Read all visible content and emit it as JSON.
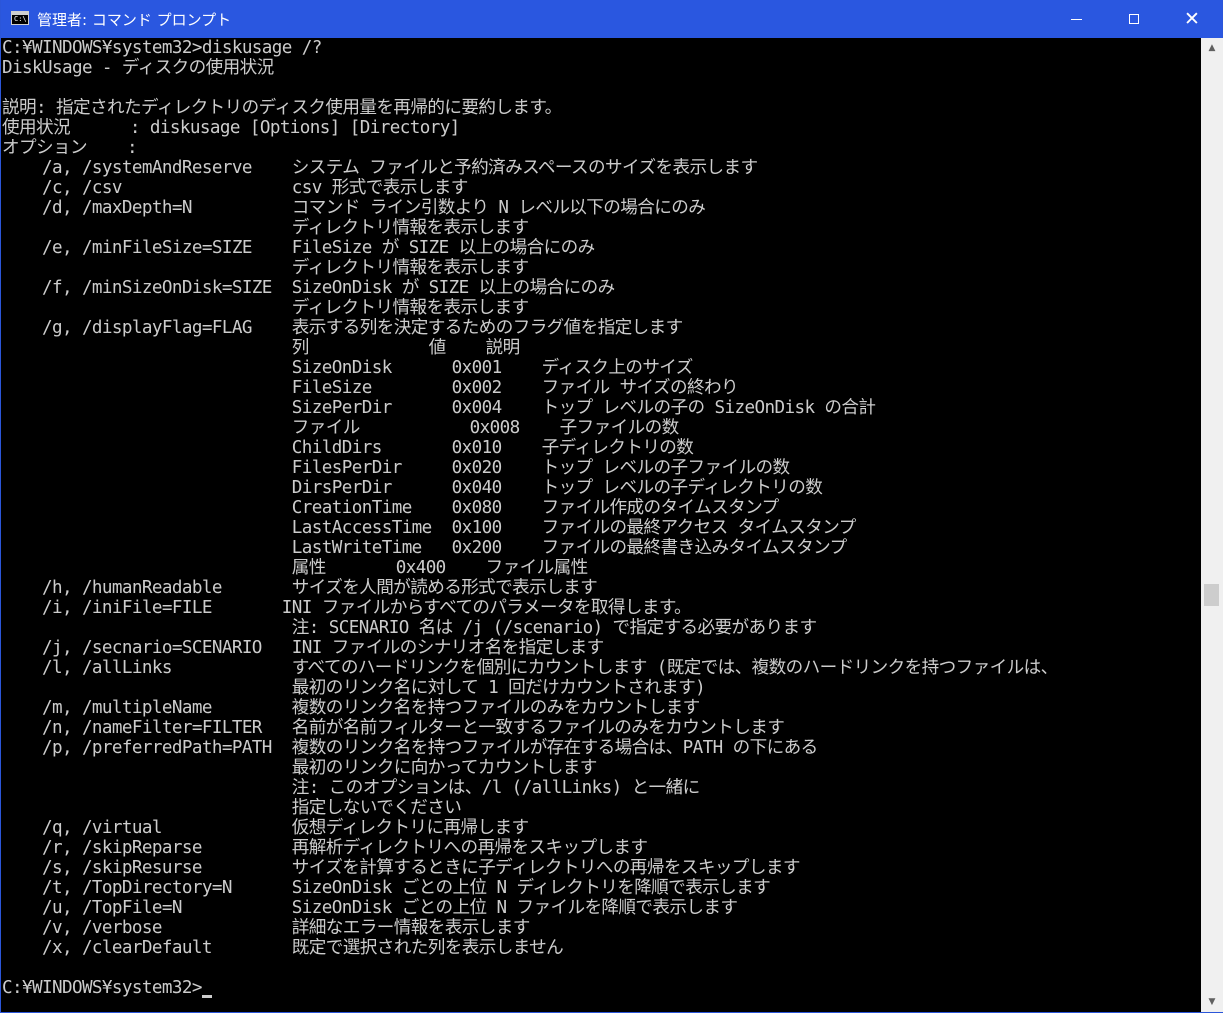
{
  "window": {
    "title": "管理者: コマンド プロンプト",
    "icon_text": "C:\\",
    "buttons": {
      "minimize": "minimize",
      "maximize": "maximize",
      "close": "✕"
    }
  },
  "console": {
    "lines": [
      "C:¥WINDOWS¥system32>diskusage /?",
      "DiskUsage - ディスクの使用状況",
      "",
      "説明: 指定されたディレクトリのディスク使用量を再帰的に要約します。",
      "使用状況      : diskusage [Options] [Directory]",
      "オプション    :",
      "    /a, /systemAndReserve    システム ファイルと予約済みスペースのサイズを表示します",
      "    /c, /csv                 csv 形式で表示します",
      "    /d, /maxDepth=N          コマンド ライン引数より N レベル以下の場合にのみ",
      "                             ディレクトリ情報を表示します",
      "    /e, /minFileSize=SIZE    FileSize が SIZE 以上の場合にのみ",
      "                             ディレクトリ情報を表示します",
      "    /f, /minSizeOnDisk=SIZE  SizeOnDisk が SIZE 以上の場合にのみ",
      "                             ディレクトリ情報を表示します",
      "    /g, /displayFlag=FLAG    表示する列を決定するためのフラグ値を指定します",
      "                             列            値    説明",
      "                             SizeOnDisk      0x001    ディスク上のサイズ",
      "                             FileSize        0x002    ファイル サイズの終わり",
      "                             SizePerDir      0x004    トップ レベルの子の SizeOnDisk の合計",
      "                             ファイル           0x008    子ファイルの数",
      "                             ChildDirs       0x010    子ディレクトリの数",
      "                             FilesPerDir     0x020    トップ レベルの子ファイルの数",
      "                             DirsPerDir      0x040    トップ レベルの子ディレクトリの数",
      "                             CreationTime    0x080    ファイル作成のタイムスタンプ",
      "                             LastAccessTime  0x100    ファイルの最終アクセス タイムスタンプ",
      "                             LastWriteTime   0x200    ファイルの最終書き込みタイムスタンプ",
      "                             属性       0x400    ファイル属性",
      "    /h, /humanReadable       サイズを人間が読める形式で表示します",
      "    /i, /iniFile=FILE       INI ファイルからすべてのパラメータを取得します。",
      "                             注: SCENARIO 名は /j (/scenario) で指定する必要があります",
      "    /j, /secnario=SCENARIO   INI ファイルのシナリオ名を指定します",
      "    /l, /allLinks            すべてのハードリンクを個別にカウントします (既定では、複数のハードリンクを持つファイルは、",
      "                             最初のリンク名に対して 1 回だけカウントされます)",
      "    /m, /multipleName        複数のリンク名を持つファイルのみをカウントします",
      "    /n, /nameFilter=FILTER   名前が名前フィルターと一致するファイルのみをカウントします",
      "    /p, /preferredPath=PATH  複数のリンク名を持つファイルが存在する場合は、PATH の下にある",
      "                             最初のリンクに向かってカウントします",
      "                             注: このオプションは、/l (/allLinks) と一緒に",
      "                             指定しないでください",
      "    /q, /virtual             仮想ディレクトリに再帰します",
      "    /r, /skipReparse         再解析ディレクトリへの再帰をスキップします",
      "    /s, /skipResurse         サイズを計算するときに子ディレクトリへの再帰をスキップします",
      "    /t, /TopDirectory=N      SizeOnDisk ごとの上位 N ディレクトリを降順で表示します",
      "    /u, /TopFile=N           SizeOnDisk ごとの上位 N ファイルを降順で表示します",
      "    /v, /verbose             詳細なエラー情報を表示します",
      "    /x, /clearDefault        既定で選択された列を表示しません",
      "",
      "C:¥WINDOWS¥system32>"
    ]
  },
  "scrollbar": {
    "up_arrow": "▲",
    "down_arrow": "▼"
  }
}
